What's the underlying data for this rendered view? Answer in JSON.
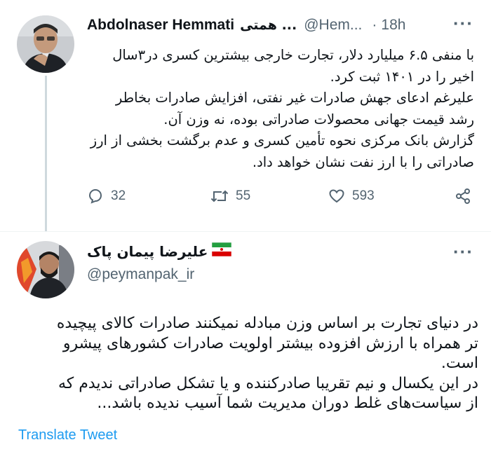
{
  "tweet1": {
    "author_name": "Abdolnaser Hemmati",
    "author_name_rtl": "همتی ...",
    "handle": "@Hem...",
    "sep": "·",
    "time": "18h",
    "lines": [
      "با منفی ۶.۵ میلیارد دلار، تجارت خارجی بیشترین کسری در۳سال",
      "اخیر را در ۱۴۰۱ ثبت کرد.",
      "علیرغم ادعای جهش صادرات غیر نفتی، افزایش صادرات بخاطر",
      "رشد قیمت جهانی محصولات صادراتی بوده، نه وزن آن.",
      "گزارش بانک مرکزی نحوه تأمین کسری و عدم برگشت بخشی از ارز",
      "صادراتی را با ارز نفت نشان خواهد داد."
    ],
    "actions": {
      "replies": "32",
      "retweets": "55",
      "likes": "593"
    }
  },
  "tweet2": {
    "author_name": "علیرضا پیمان پاک",
    "handle": "@peymanpak_ir",
    "lines": [
      "در دنیای تجارت بر اساس وزن مبادله نمیکنند صادرات کالای پیچیده",
      "تر همراه با ارزش افزوده بیشتر اولویت صادرات کشورهای پیشرو",
      "است.",
      "در این یکسال و نیم تقریبا صادرکننده و یا تشکل صادراتی ندیدم که",
      "از سیاست‌های غلط دوران مدیریت شما آسیب ندیده باشد..."
    ],
    "translate_label": "Translate Tweet"
  },
  "colors": {
    "text": "#0f1419",
    "muted": "#536471",
    "link": "#1d9bf0",
    "thread_line": "#cfd9de"
  },
  "icons": [
    "reply-icon",
    "retweet-icon",
    "like-icon",
    "share-icon",
    "more-icon",
    "iran-flag-icon"
  ]
}
